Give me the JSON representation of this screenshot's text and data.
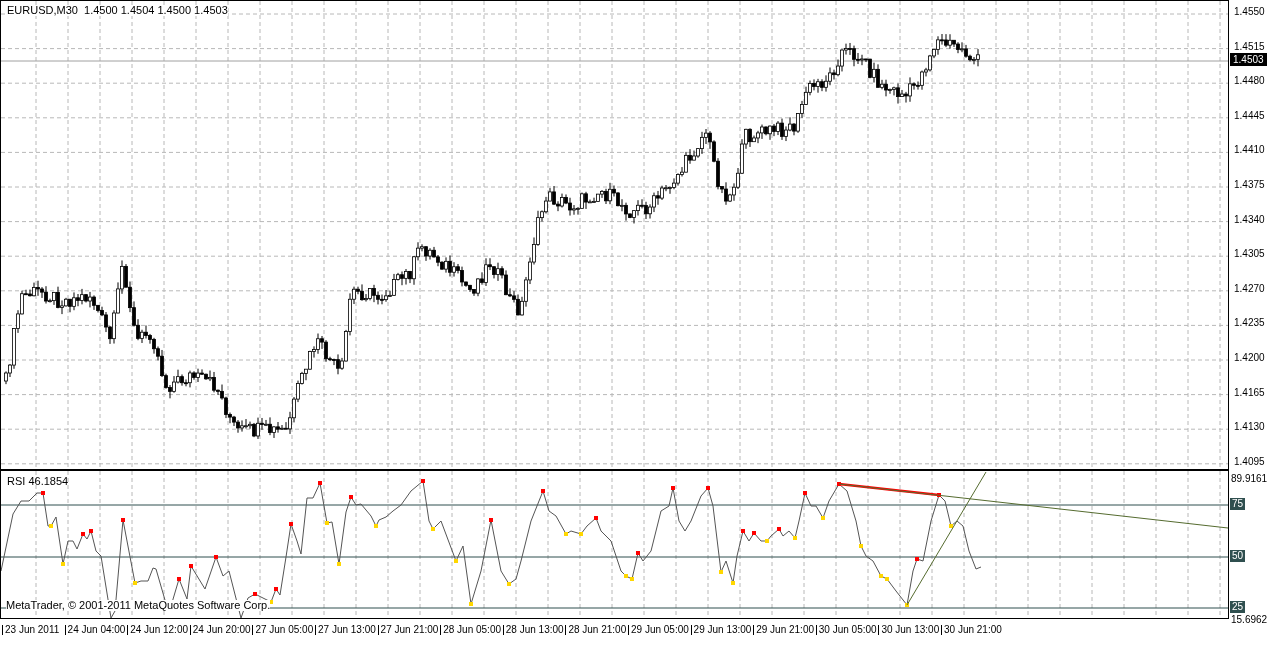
{
  "chart_header": "EURUSD,M30  1.4500 1.4504 1.4500 1.4503",
  "price_axis": {
    "ticks": [
      "1.4550",
      "1.4515",
      "1.4480",
      "1.4445",
      "1.4410",
      "1.4375",
      "1.4340",
      "1.4305",
      "1.4270",
      "1.4235",
      "1.4200",
      "1.4165",
      "1.4130",
      "1.4095"
    ],
    "current_price": "1.4503"
  },
  "rsi_panel": {
    "label": "RSI 46.1854",
    "max": "89.9161",
    "min": "15.6962",
    "levels": [
      "75",
      "50",
      "25"
    ]
  },
  "copyright": "MetaTrader, © 2001-2011 MetaQuotes Software Corp.",
  "time_axis": [
    "23 Jun 2011",
    "24 Jun 04:00",
    "24 Jun 12:00",
    "24 Jun 20:00",
    "27 Jun 05:00",
    "27 Jun 13:00",
    "27 Jun 21:00",
    "28 Jun 05:00",
    "28 Jun 13:00",
    "28 Jun 21:00",
    "29 Jun 05:00",
    "29 Jun 13:00",
    "29 Jun 21:00",
    "30 Jun 05:00",
    "30 Jun 13:00",
    "30 Jun 21:00"
  ]
}
